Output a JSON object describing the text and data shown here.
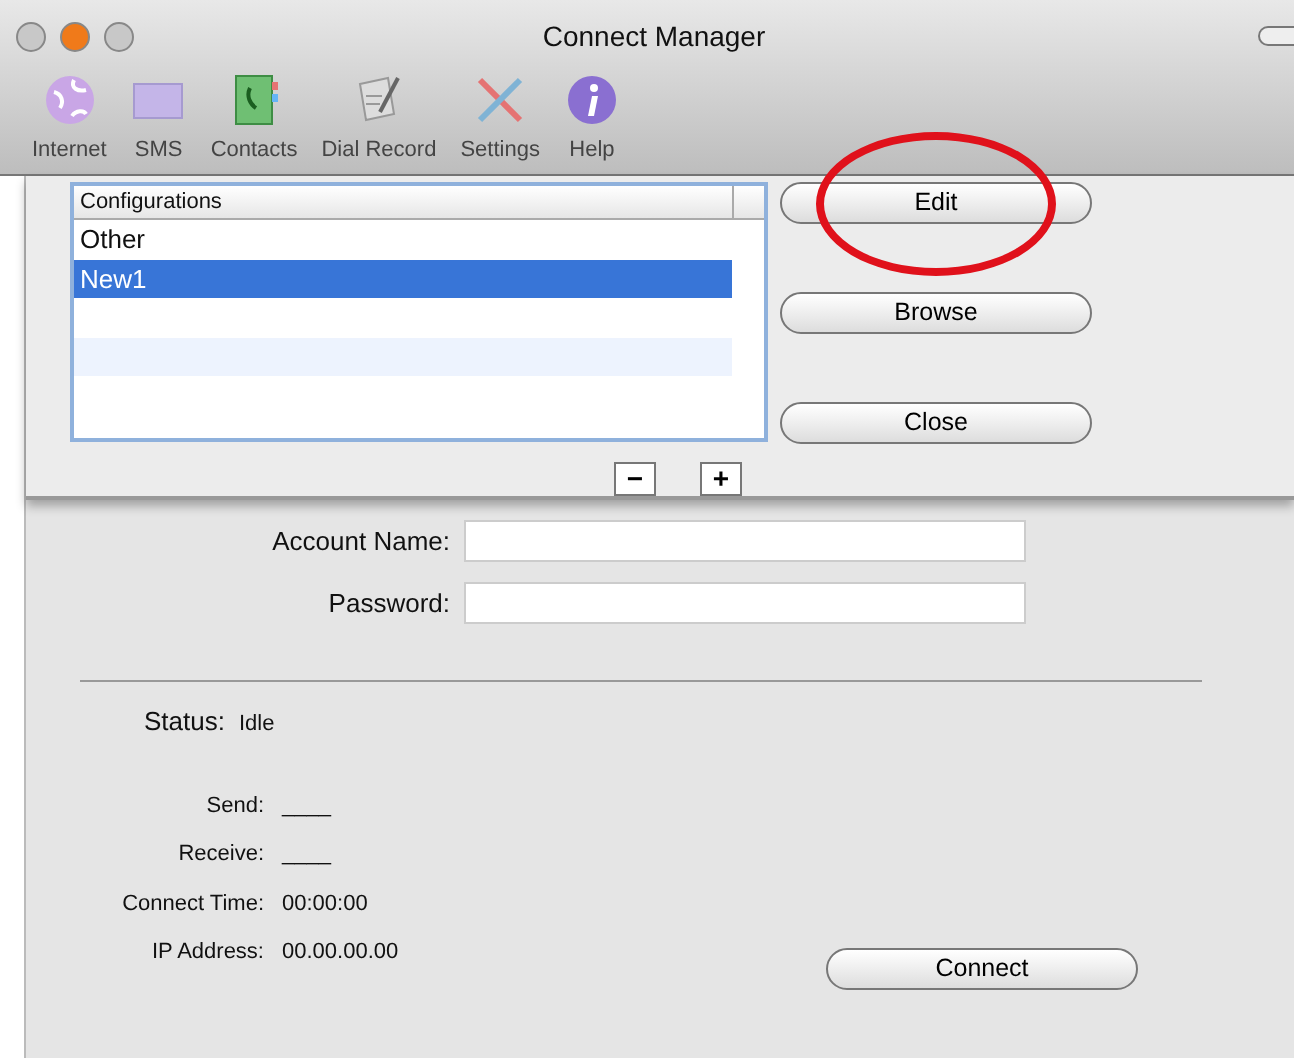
{
  "window": {
    "title": "Connect Manager",
    "lights": [
      {
        "color": "#c8c8c8"
      },
      {
        "color": "#f07a1a"
      },
      {
        "color": "#c8c8c8"
      }
    ]
  },
  "toolbar": [
    {
      "label": "Internet",
      "kind": "globe"
    },
    {
      "label": "SMS",
      "kind": "envelope"
    },
    {
      "label": "Contacts",
      "kind": "book"
    },
    {
      "label": "Dial Record",
      "kind": "document"
    },
    {
      "label": "Settings",
      "kind": "tools"
    },
    {
      "label": "Help",
      "kind": "info"
    }
  ],
  "sheet": {
    "configurations": {
      "header": "Configurations",
      "rows": [
        {
          "label": "Other",
          "selected": false
        },
        {
          "label": "New1",
          "selected": true
        }
      ]
    },
    "buttons": [
      {
        "label": "Edit",
        "annotated": true
      },
      {
        "label": "Browse",
        "annotated": false
      },
      {
        "label": "Close",
        "annotated": false
      }
    ],
    "remove_button": "−",
    "add_button": "+"
  },
  "form": [
    {
      "label": "Account Name:"
    },
    {
      "label": "Password:"
    }
  ],
  "status": {
    "label": "Status:",
    "value": "Idle"
  },
  "stats": [
    {
      "label": "Send:",
      "value": "____"
    },
    {
      "label": "Receive:",
      "value": "____"
    },
    {
      "label": "Connect Time:",
      "value": "00:00:00"
    },
    {
      "label": "IP Address:",
      "value": "00.00.00.00"
    }
  ],
  "connect_button": "Connect"
}
